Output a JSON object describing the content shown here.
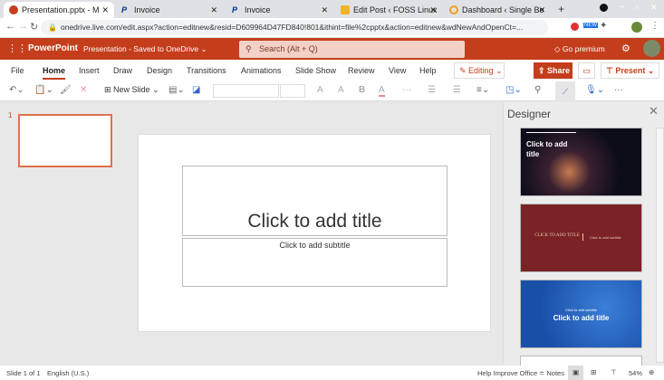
{
  "browser": {
    "tabs": [
      {
        "title": "Presentation.pptx - M",
        "icon": "powerpoint-icon"
      },
      {
        "title": "Invoice",
        "icon": "paypal-icon"
      },
      {
        "title": "Invoice",
        "icon": "paypal-icon"
      },
      {
        "title": "Edit Post ‹ FOSS Linux",
        "icon": "wordpress-icon"
      },
      {
        "title": "Dashboard ‹ Single Bo",
        "icon": "dashboard-icon"
      }
    ],
    "url": "onedrive.live.com/edit.aspx?action=editnew&resid=D609964D47FD840!801&ithint=file%2cpptx&action=editnew&wdNewAndOpenCt=..."
  },
  "app": {
    "name": "PowerPoint",
    "doc_title": "Presentation",
    "save_status": "Saved to OneDrive",
    "search_placeholder": "Search (Alt + Q)",
    "go_premium": "Go premium"
  },
  "ribbon": {
    "tabs": [
      "File",
      "Home",
      "Insert",
      "Draw",
      "Design",
      "Transitions",
      "Animations",
      "Slide Show",
      "Review",
      "View",
      "Help"
    ],
    "active": "Home",
    "editing": "Editing",
    "share": "Share",
    "present": "Present",
    "new_slide": "New Slide"
  },
  "thumbnail": {
    "number": "1"
  },
  "slide": {
    "title_placeholder": "Click to add title",
    "subtitle_placeholder": "Click to add subtitle"
  },
  "designer": {
    "title": "Designer",
    "designs": [
      {
        "title": "Click to add title"
      },
      {
        "title": "CLICK TO ADD TITLE",
        "subtitle": "Click to add subtitle"
      },
      {
        "title": "Click to add title",
        "subtitle": "Click to add subtitle"
      }
    ]
  },
  "status": {
    "slide": "Slide 1 of 1",
    "language": "English (U.S.)",
    "help": "Help Improve Office",
    "notes": "Notes",
    "zoom": "54%"
  },
  "colors": {
    "brand": "#c43e1c"
  }
}
